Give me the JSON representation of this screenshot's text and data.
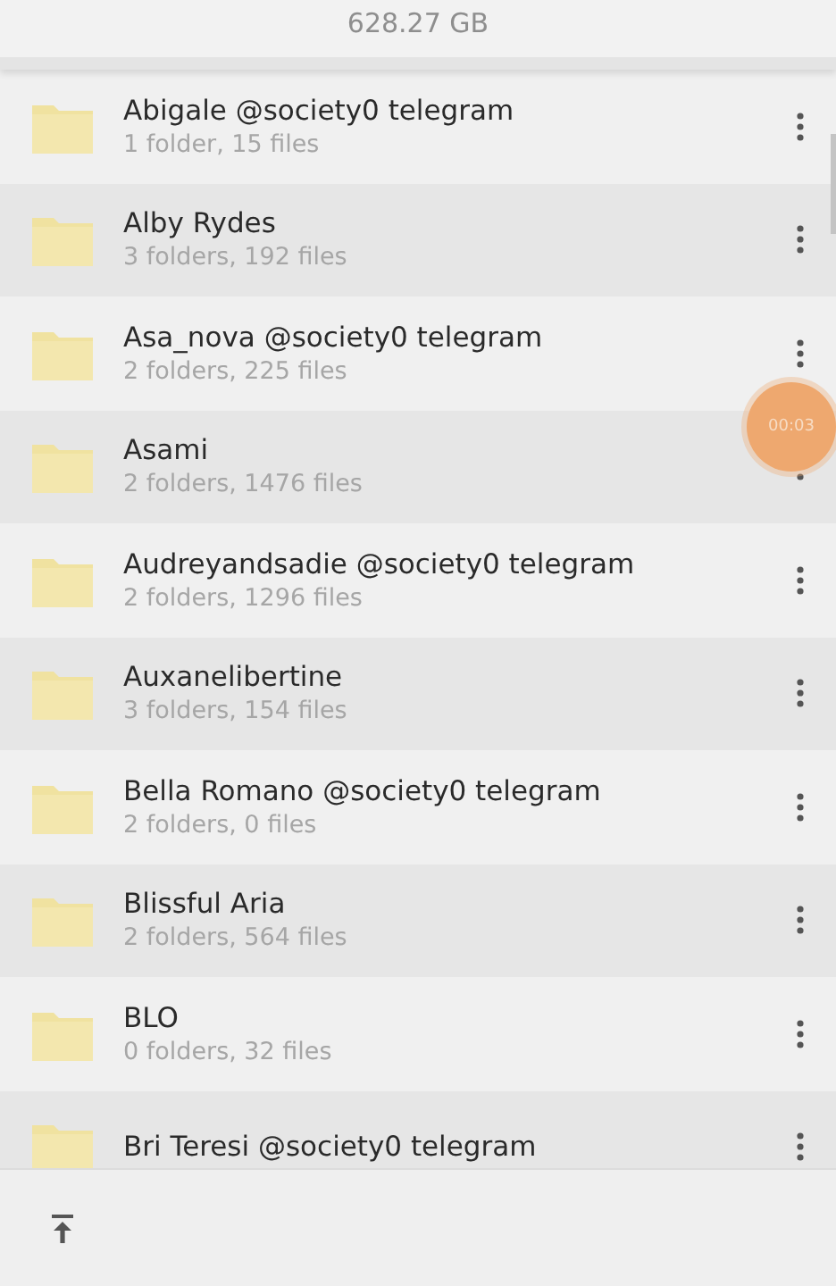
{
  "storage": {
    "size": "628.27 GB"
  },
  "folders": [
    {
      "name": "Abigale @society0 telegram",
      "info": "1 folder, 15 files"
    },
    {
      "name": "Alby Rydes",
      "info": "3 folders, 192 files"
    },
    {
      "name": "Asa_nova @society0 telegram",
      "info": "2 folders, 225 files"
    },
    {
      "name": "Asami",
      "info": "2 folders, 1476 files"
    },
    {
      "name": "Audreyandsadie @society0 telegram",
      "info": "2 folders, 1296 files"
    },
    {
      "name": "Auxanelibertine",
      "info": "3 folders, 154 files"
    },
    {
      "name": "Bella Romano @society0 telegram",
      "info": "2 folders, 0 files"
    },
    {
      "name": "Blissful Aria",
      "info": "2 folders, 564 files"
    },
    {
      "name": "BLO",
      "info": "0 folders, 32 files"
    },
    {
      "name": "Bri Teresi @society0 telegram"
    }
  ],
  "recording_timer": "00:03"
}
